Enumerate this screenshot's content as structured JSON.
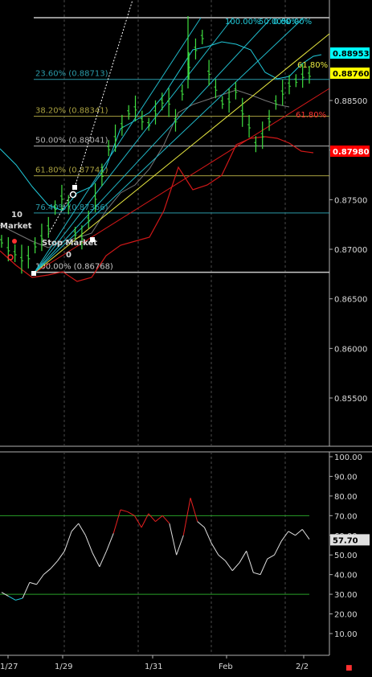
{
  "chart_data": [
    {
      "type": "candlestick",
      "panel": "price",
      "x_labels": [
        "1/27",
        "1/29",
        "1/31",
        "Feb",
        "2/2"
      ],
      "y_ticks": [
        "0.88953",
        "0.88500",
        "0.88000",
        "0.87500",
        "0.87000",
        "0.86500",
        "0.86000",
        "0.85500"
      ],
      "ylim": [
        0.8515,
        0.8932
      ],
      "last_price": "0.88760",
      "last_price_badge_color": "#ffff00",
      "upper_band_value": "0.88953",
      "upper_band_badge_color": "#00ffff",
      "lower_band_value": "0.87980",
      "lower_band_badge_color": "#ff0000",
      "fib_retracements": [
        {
          "label": "100.00% (0.86768)",
          "value": 0.86768
        },
        {
          "label": "76.40% (0.87366)",
          "value": 0.87366
        },
        {
          "label": "61.80% (0.87741)",
          "value": 0.87741
        },
        {
          "label": "50.00% (0.88041)",
          "value": 0.88041
        },
        {
          "label": "38.20% (0.88341)",
          "value": 0.88341
        },
        {
          "label": "23.60% (0.88713)",
          "value": 0.88713
        }
      ],
      "fan_labels": [
        "100.00%",
        "50.00%",
        "0.00%",
        "50.00%",
        "61.80%"
      ],
      "order_labels": [
        "10",
        "Market",
        "Stop Market",
        "0"
      ],
      "candles_approx": [
        0.8708,
        0.87,
        0.8696,
        0.869,
        0.8692,
        0.8704,
        0.8712,
        0.8722,
        0.8742,
        0.8752,
        0.8745,
        0.8716,
        0.8712,
        0.873,
        0.8752,
        0.8775,
        0.8802,
        0.8812,
        0.8825,
        0.8838,
        0.8842,
        0.883,
        0.8826,
        0.8838,
        0.8849,
        0.8848,
        0.883,
        0.8858,
        0.8885,
        0.8902,
        0.8914,
        0.8878,
        0.8862,
        0.8848,
        0.885,
        0.886,
        0.8838,
        0.8824,
        0.8806,
        0.8815,
        0.883,
        0.8848,
        0.8858,
        0.8866,
        0.887,
        0.8875,
        0.8876
      ]
    },
    {
      "type": "line",
      "panel": "oscillator",
      "y_ticks": [
        "100.00",
        "90.00",
        "80.00",
        "70.00",
        "60.00",
        "50.00",
        "40.00",
        "30.00",
        "20.00",
        "10.00"
      ],
      "ylim": [
        0,
        102
      ],
      "levels": [
        70,
        30
      ],
      "last_value": "57.70",
      "values": [
        31,
        29,
        27,
        28,
        36,
        35,
        40,
        43,
        47,
        52,
        62,
        66,
        60,
        51,
        44,
        52,
        61,
        73,
        72,
        70,
        64,
        71,
        67,
        70,
        66,
        50,
        60,
        79,
        67,
        64,
        56,
        50,
        47,
        42,
        46,
        52,
        41,
        40,
        48,
        50,
        57,
        62,
        60,
        63,
        58
      ]
    }
  ]
}
